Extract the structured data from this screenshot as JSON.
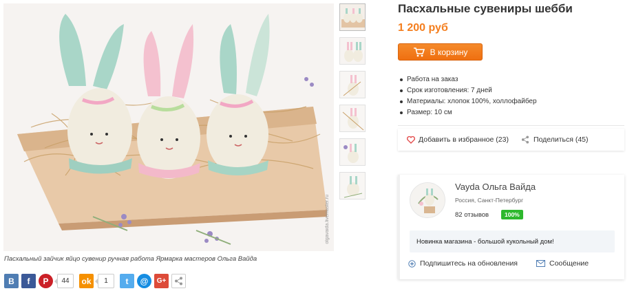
{
  "product": {
    "title": "Пасхальные сувениры шебби",
    "price": "1 200 руб",
    "cart_button": "В корзину",
    "caption": "Пасхальный зайчик яйцо сувенир ручная работа Ярмарка мастеров Ольга Вайда",
    "watermark": "olgavaida.livemaster.ru",
    "features": [
      "Работа на заказ",
      "Срок изготовления: 7 дней",
      "Материалы: хлопок 100%, холлофайбер",
      "Размер: 10 см"
    ],
    "favorite_label": "Добавить в избранное (23)",
    "share_label": "Поделиться (45)"
  },
  "seller": {
    "name": "Vayda Ольга Вайда",
    "location": "Россия, Санкт-Петербург",
    "reviews": "82 отзывов",
    "rating_badge": "100%",
    "news": "Новинка магазина - большой кукольный дом!",
    "subscribe": "Подпишитесь на обновления",
    "message": "Сообщение"
  },
  "social": {
    "pinterest_count": "44",
    "ok_count": "1",
    "vk": "В",
    "fb": "f",
    "pin": "P",
    "ok": "ok",
    "tw": "t",
    "mail": "@",
    "gp": "G+"
  },
  "colors": {
    "accent": "#f47e1e",
    "badge": "#2db82d",
    "heart": "#e34b4b"
  },
  "icons": [
    "cart-icon",
    "heart-icon",
    "share-icon",
    "plus-circle-icon",
    "envelope-icon"
  ]
}
